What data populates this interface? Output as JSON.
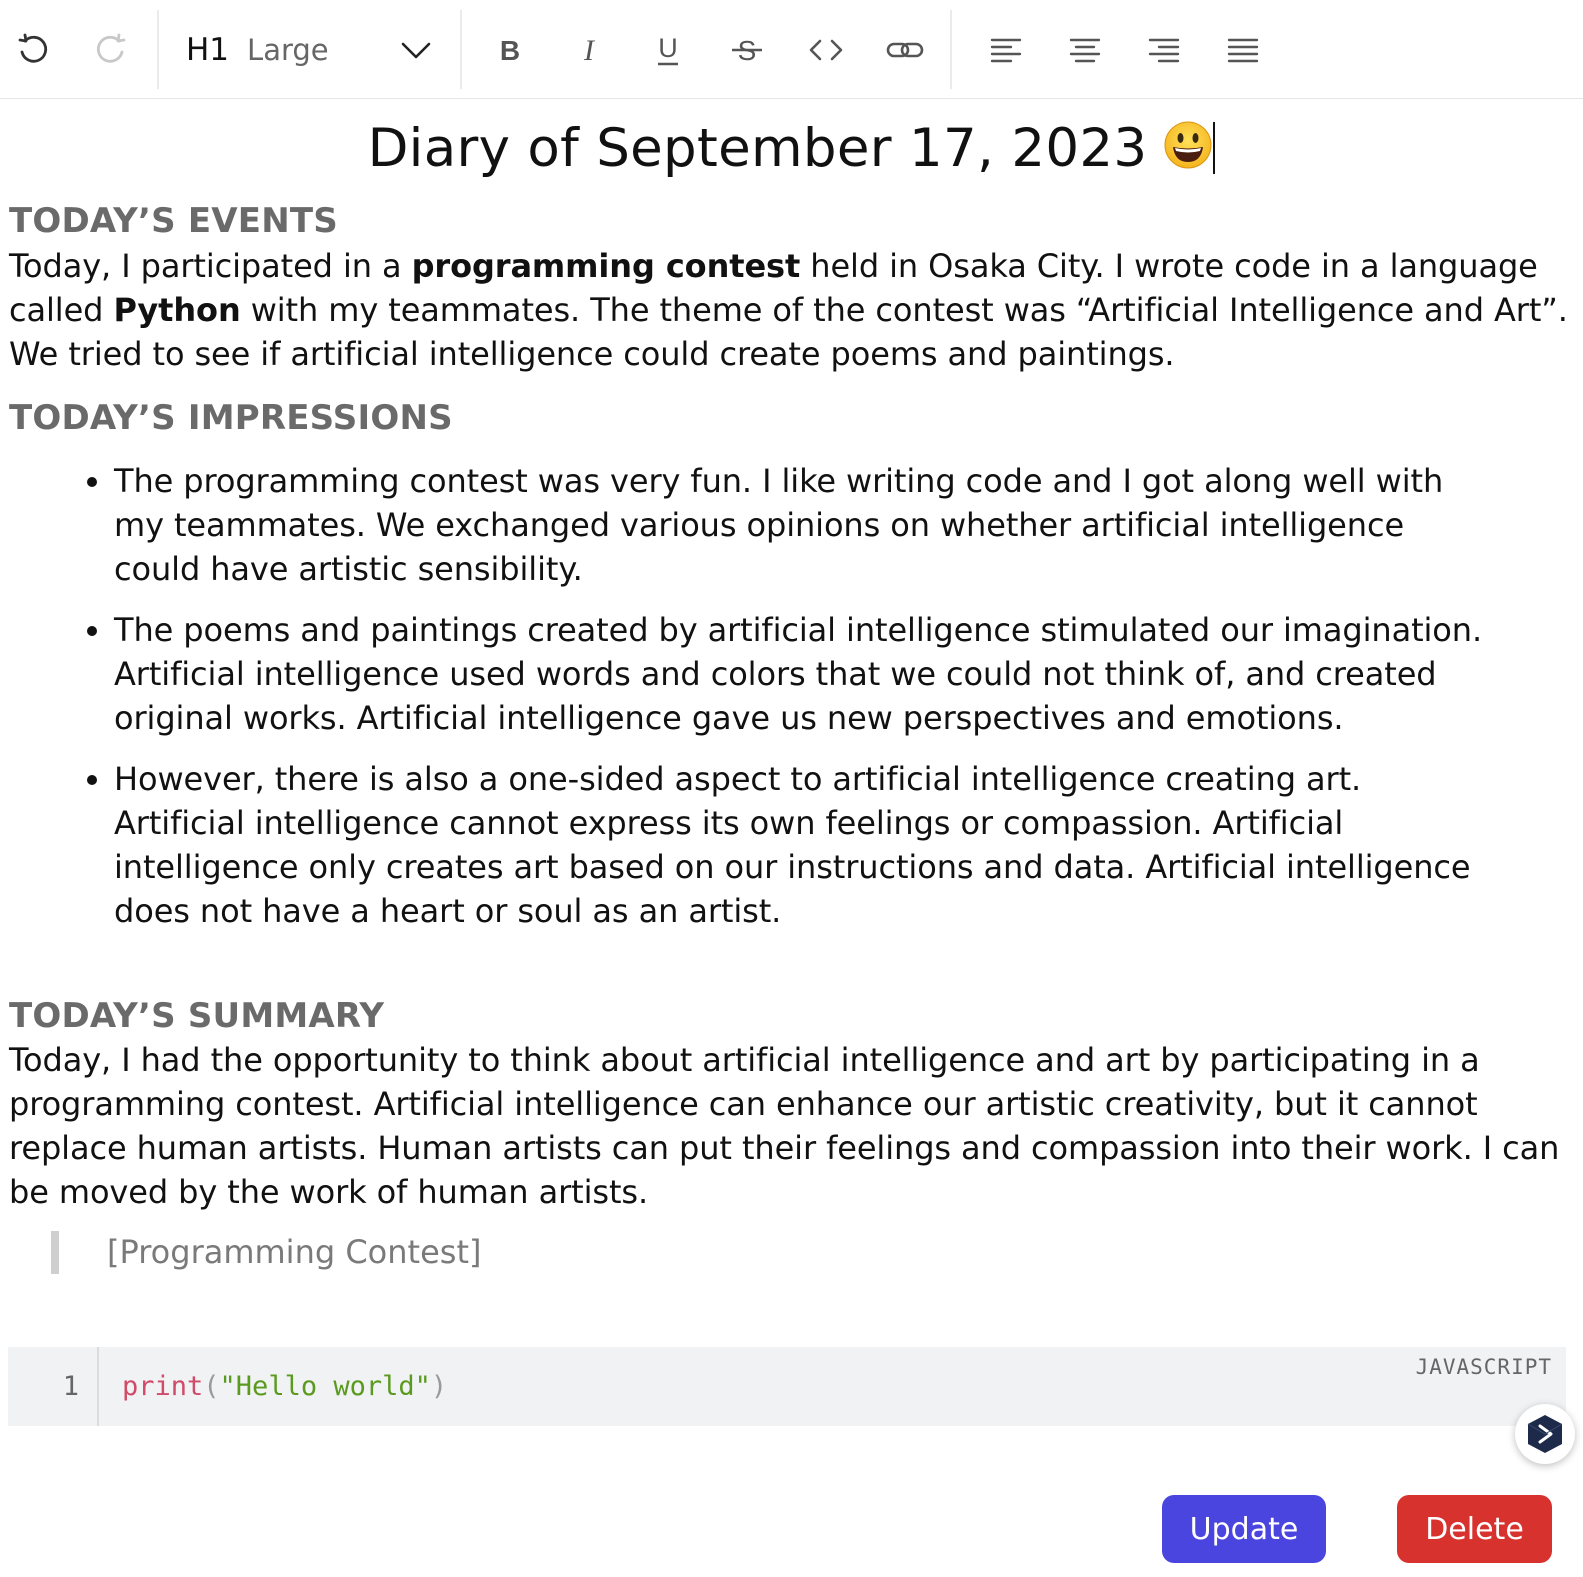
{
  "toolbar": {
    "heading_code": "H1",
    "heading_label": "Large",
    "icons": [
      "undo-icon",
      "redo-icon",
      "chevron-down-icon",
      "bold-icon",
      "italic-icon",
      "underline-icon",
      "strikethrough-icon",
      "code-icon",
      "link-icon",
      "align-left-icon",
      "align-center-icon",
      "align-right-icon",
      "align-justify-icon"
    ]
  },
  "document": {
    "title": "Diary of September 17, 2023",
    "title_emoji": "grinning-face-emoji",
    "events": {
      "heading": "TODAY’S EVENTS",
      "p1": "Today, I participated in a ",
      "b1": "programming contest",
      "p2": " held in Osaka City. I wrote code in a language called ",
      "b2": "Python",
      "p3": " with my teammates. The theme of the contest was “Artificial Intelligence and Art”. We tried to see if artificial intelligence could create poems and paintings."
    },
    "impressions": {
      "heading": "TODAY’S IMPRESSIONS",
      "items": [
        "The programming contest was very fun. I like writing code and I got along well with my teammates. We exchanged various opinions on whether artificial intelligence could have artistic sensibility.",
        "The poems and paintings created by artificial intelligence stimulated our imagination. Artificial intelligence used words and colors that we could not think of, and created original works. Artificial intelligence gave us new perspectives and emotions.",
        "However, there is also a one-sided aspect to artificial intelligence creating art. Artificial intelligence cannot express its own feelings or compassion. Artificial intelligence only creates art based on our instructions and data. Artificial intelligence does not have a heart or soul as an artist."
      ]
    },
    "summary": {
      "heading": "TODAY’S SUMMARY",
      "text": "Today, I had the opportunity to think about artificial intelligence and art by participating in a programming contest. Artificial intelligence can enhance our artistic creativity, but it cannot replace human artists. Human artists can put their feelings and compassion into their work. I can be moved by the work of human artists."
    },
    "quote": "[Programming Contest]",
    "code": {
      "line_number": "1",
      "fn": "print",
      "open": "(",
      "string": "\"Hello world\"",
      "close": ")",
      "language": "JAVASCRIPT"
    }
  },
  "actions": {
    "update_label": "Update",
    "delete_label": "Delete"
  },
  "colors": {
    "update_button": "#4b45e0",
    "delete_button": "#d7322e",
    "heading_gray": "#6a6a6a"
  }
}
